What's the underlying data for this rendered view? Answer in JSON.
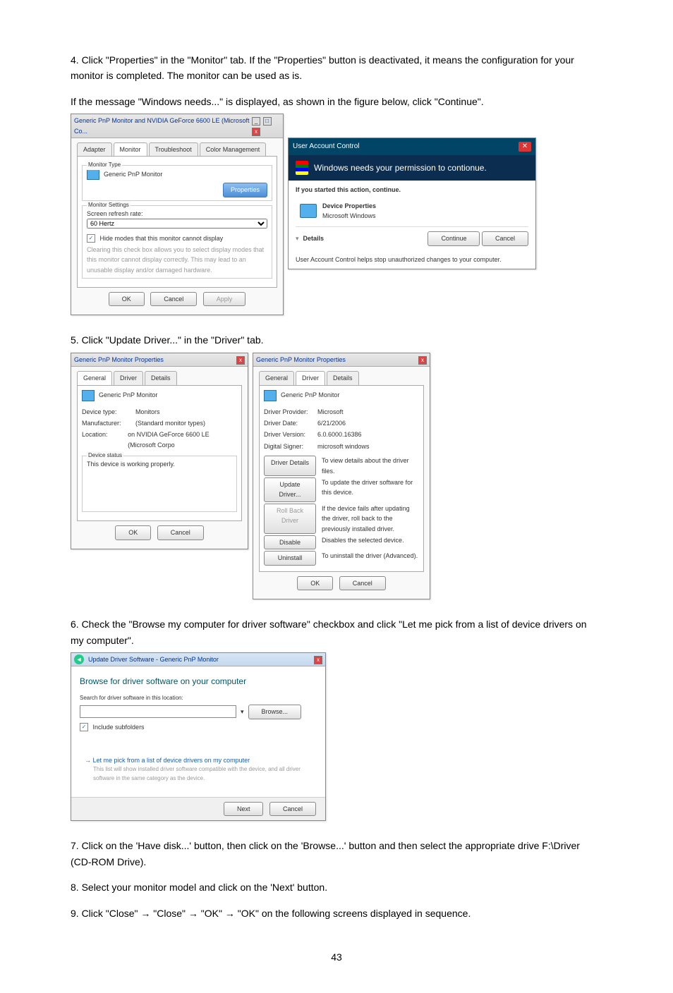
{
  "page_number": "43",
  "steps": {
    "s4a": "4. Click \"Properties\" in the \"Monitor\" tab. If the \"Properties\" button is deactivated, it means the configuration for your monitor is completed. The monitor can be used as is.",
    "s4b": "If the message \"Windows needs...\" is displayed, as shown in the figure below, click \"Continue\".",
    "s5": "5. Click \"Update Driver...\" in the \"Driver\" tab.",
    "s6": "6. Check the \"Browse my computer for driver software\" checkbox and click \"Let me pick from a list of device drivers on my computer\".",
    "s7": "7. Click on the 'Have disk...' button, then click on the 'Browse...' button and then select the appropriate drive F:\\Driver (CD-ROM Drive).",
    "s8": "8. Select your monitor model and click on the 'Next' button.",
    "s9": "9. Click \"Close\"  →  \"Close\"  →  \"OK\"  →  \"OK\" on the following screens displayed in sequence."
  },
  "dlgA": {
    "title": "Generic PnP Monitor and NVIDIA GeForce 6600 LE (Microsoft Co...",
    "tabs": {
      "adapter": "Adapter",
      "monitor": "Monitor",
      "troubleshoot": "Troubleshoot",
      "color": "Color Management"
    },
    "mt_label": "Monitor Type",
    "mt_value": "Generic PnP Monitor",
    "properties": "Properties",
    "ms_label": "Monitor Settings",
    "refresh_lbl": "Screen refresh rate:",
    "refresh_val": "60 Hertz",
    "hide": "Hide modes that this monitor cannot display",
    "hide_text": "Clearing this check box allows you to select display modes that this monitor cannot display correctly. This may lead to an unusable display and/or damaged hardware.",
    "ok": "OK",
    "cancel": "Cancel",
    "apply": "Apply"
  },
  "uac": {
    "title": "User Account Control",
    "band": "Windows needs your permission to contionue.",
    "if_started": "If you started this action, continue.",
    "dp": "Device Properties",
    "mw": "Microsoft Windows",
    "details": "Details",
    "continue": "Continue",
    "cancel": "Cancel",
    "foot": "User Account Control helps stop unauthorized changes to your computer."
  },
  "dlgB1": {
    "title": "Generic PnP Monitor Properties",
    "tabs": {
      "general": "General",
      "driver": "Driver",
      "details": "Details"
    },
    "name": "Generic PnP Monitor",
    "k_type": "Device type:",
    "v_type": "Monitors",
    "k_manu": "Manufacturer:",
    "v_manu": "(Standard monitor types)",
    "k_loc": "Location:",
    "v_loc": "on NVIDIA GeForce 6600 LE (Microsoft Corpo",
    "status_lbl": "Device status",
    "status_txt": "This device is working properly.",
    "ok": "OK",
    "cancel": "Cancel"
  },
  "dlgB2": {
    "title": "Generic PnP Monitor Properties",
    "name": "Generic PnP Monitor",
    "k_prov": "Driver Provider:",
    "v_prov": "Microsoft",
    "k_date": "Driver Date:",
    "v_date": "6/21/2006",
    "k_ver": "Driver Version:",
    "v_ver": "6.0.6000.16386",
    "k_signer": "Digital Signer:",
    "v_signer": "microsoft windows",
    "b_details": "Driver Details",
    "t_details": "To view details about the driver files.",
    "b_update": "Update Driver...",
    "t_update": "To update the driver software for this device.",
    "b_roll": "Roll Back Driver",
    "t_roll": "If the device fails after updating the driver, roll back to the previously installed driver.",
    "b_disable": "Disable",
    "t_disable": "Disables the selected device.",
    "b_uninstall": "Uninstall",
    "t_uninstall": "To uninstall the driver (Advanced).",
    "ok": "OK",
    "cancel": "Cancel"
  },
  "dlgC": {
    "crumb": "Update Driver Software - Generic PnP Monitor",
    "h1": "Browse for driver software on your computer",
    "search_lbl": "Search for driver software in this location:",
    "browse": "Browse...",
    "include": "Include subfolders",
    "opt_title": "Let me pick from a list of device drivers on my computer",
    "opt_text": "This list will show installed driver software compatible with the device, and all driver software in the same category as the device.",
    "next": "Next",
    "cancel": "Cancel"
  }
}
